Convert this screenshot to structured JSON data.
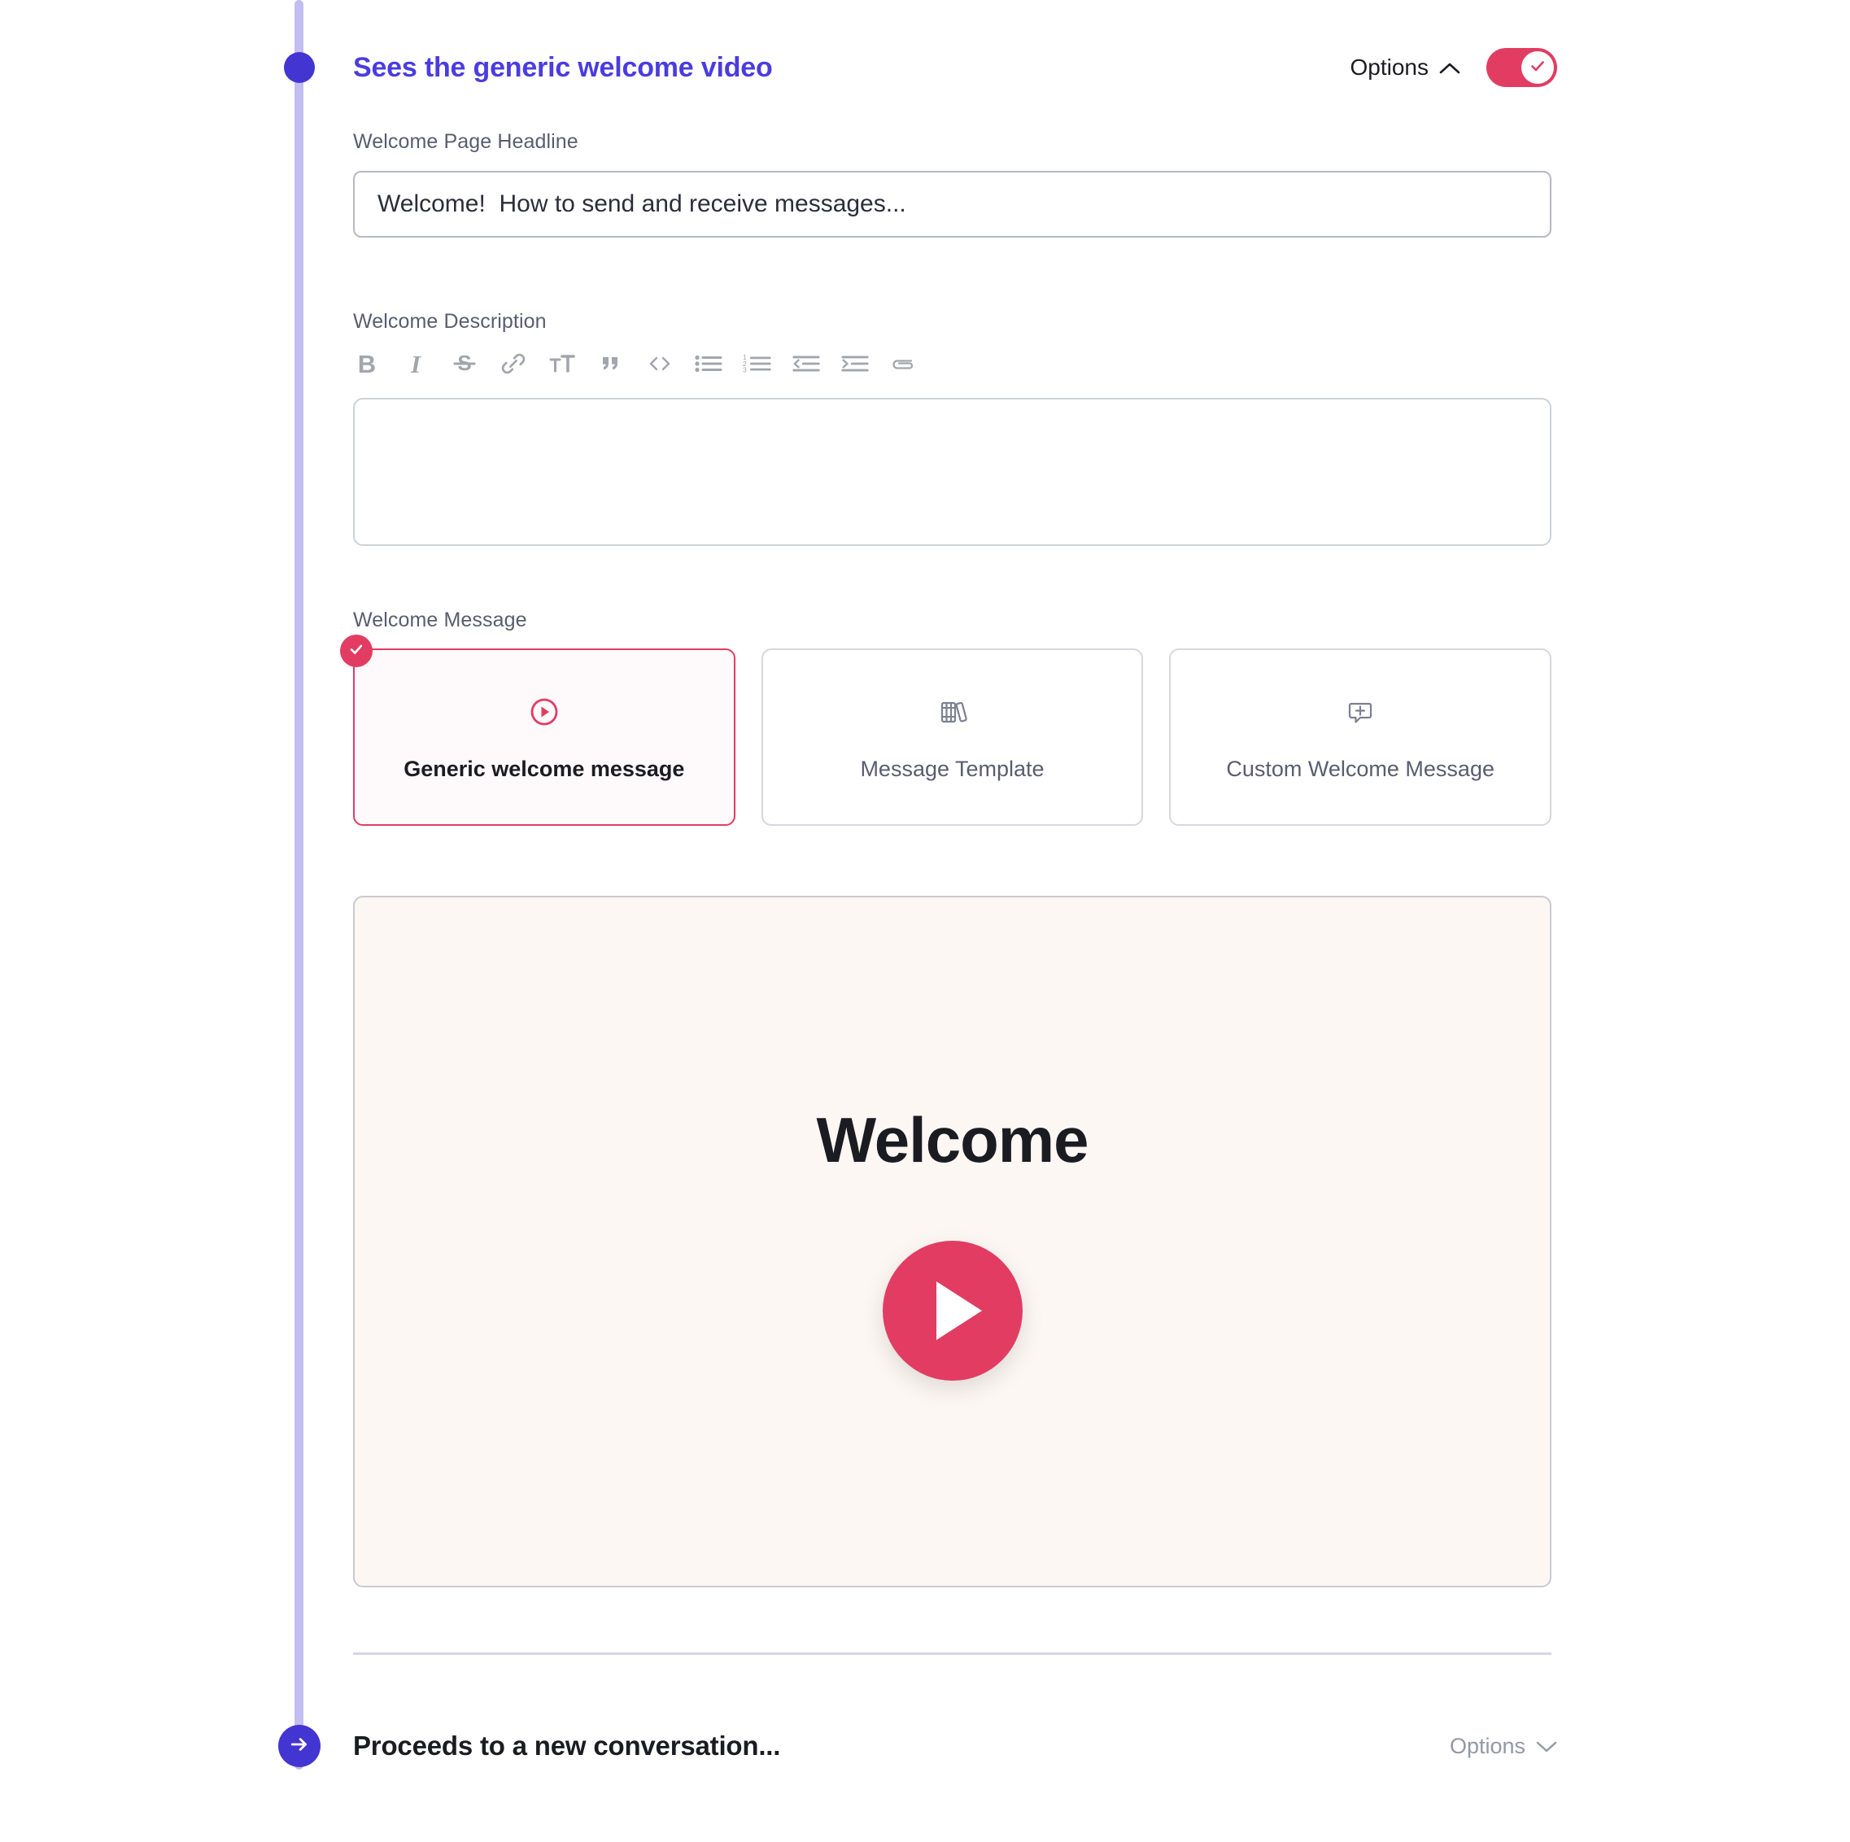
{
  "step": {
    "title": "Sees the generic welcome video",
    "options_label": "Options",
    "chevron_icon": "chevron-up-icon",
    "toggle": {
      "enabled": true,
      "icon": "check-icon",
      "color": "#E23C63"
    },
    "marker_icon": "timeline-dot-icon",
    "rail_color": "#C3BDF2",
    "accent_color": "#4335D2"
  },
  "headline": {
    "label": "Welcome Page Headline",
    "value": "Welcome!  How to send and receive messages...",
    "placeholder": "Welcome Page Headline"
  },
  "description": {
    "label": "Welcome Description",
    "value": "",
    "placeholder": "",
    "toolbar": [
      {
        "name": "bold-icon",
        "glyph": "B"
      },
      {
        "name": "italic-icon",
        "glyph": "I"
      },
      {
        "name": "strikethrough-icon",
        "glyph": "S"
      },
      {
        "name": "link-icon",
        "glyph": "link"
      },
      {
        "name": "text-size-icon",
        "glyph": "TT"
      },
      {
        "name": "blockquote-icon",
        "glyph": "”"
      },
      {
        "name": "code-icon",
        "glyph": "<>"
      },
      {
        "name": "bulleted-list-icon",
        "glyph": "list"
      },
      {
        "name": "numbered-list-icon",
        "glyph": "1 2 3"
      },
      {
        "name": "outdent-icon",
        "glyph": "outdent"
      },
      {
        "name": "indent-icon",
        "glyph": "indent"
      },
      {
        "name": "attachment-icon",
        "glyph": "paperclip"
      }
    ]
  },
  "welcome_message": {
    "label": "Welcome Message",
    "selected_index": 0,
    "options": [
      {
        "label": "Generic welcome message",
        "icon": "play-circle-icon",
        "selected": true
      },
      {
        "label": "Message Template",
        "icon": "books-icon",
        "selected": false
      },
      {
        "label": "Custom Welcome Message",
        "icon": "message-plus-icon",
        "selected": false
      }
    ],
    "badge_icon": "check-icon"
  },
  "video_preview": {
    "title": "Welcome",
    "play_icon": "play-icon",
    "background_color": "#FDF7F3",
    "play_color": "#E23C63"
  },
  "next_step": {
    "title": "Proceeds to a new conversation...",
    "options_label": "Options",
    "chevron_icon": "chevron-down-icon",
    "arrow_icon": "arrow-right-icon"
  }
}
